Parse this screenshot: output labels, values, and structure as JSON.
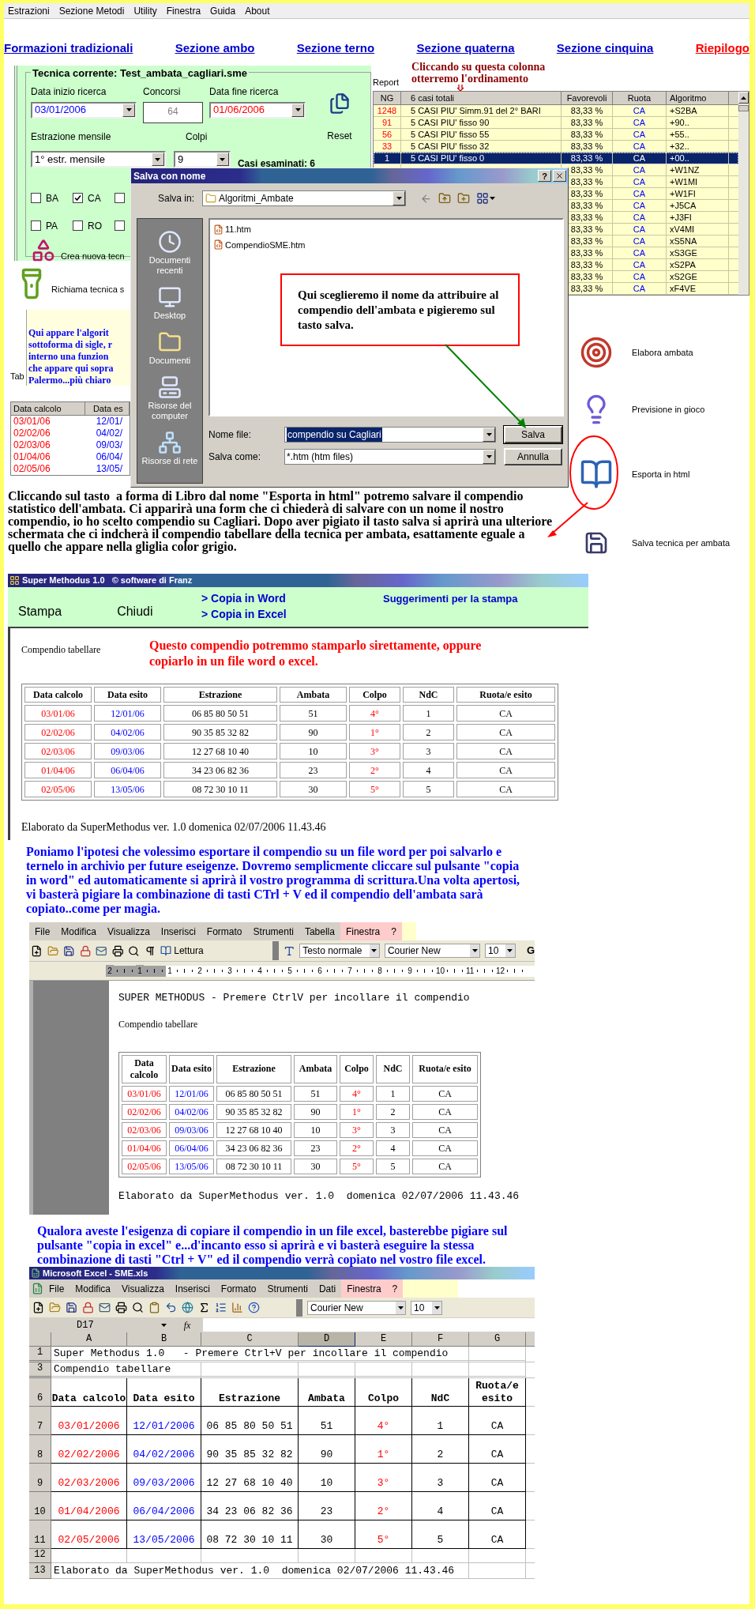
{
  "menu_bar": {
    "items": [
      "Estrazioni",
      "Sezione Metodi",
      "Utility",
      "Finestra",
      "Guida",
      "About"
    ]
  },
  "nav_links": [
    {
      "label": "Formazioni tradizionali",
      "kind": "section"
    },
    {
      "label": "Sezione ambo",
      "kind": "section"
    },
    {
      "label": "Sezione terno",
      "kind": "section"
    },
    {
      "label": "Sezione quaterna",
      "kind": "section"
    },
    {
      "label": "Sezione cinquina",
      "kind": "section"
    },
    {
      "label": "Riepilogo",
      "kind": "summary"
    }
  ],
  "technique_panel": {
    "title": "Tecnica corrente: Test_ambata_cagliari.sme",
    "start_label": "Data inizio ricerca",
    "start_value": "03/01/2006",
    "draws_label": "Concorsi",
    "draws_value": "64",
    "end_label": "Data fine ricerca",
    "end_value": "01/06/2006",
    "reset_label": "Reset",
    "monthly_label": "Estrazione mensile",
    "monthly_value": "1° estr. mensile",
    "shots_label": "Colpi",
    "shots_value": "9",
    "cases": "Casi esaminati: 6",
    "wheel_rows": [
      {
        "wheels": [
          {
            "label": "BA",
            "checked": false
          },
          {
            "label": "CA",
            "checked": true
          },
          {
            "checked": false
          }
        ]
      },
      {
        "wheels": [
          {
            "label": "PA",
            "checked": false
          },
          {
            "label": "RO",
            "checked": false
          },
          {
            "checked": false
          }
        ]
      }
    ],
    "create_label": "Crea nuova tecn"
  },
  "recall_label": "Richiama tecnica s",
  "algorithm_note": [
    "Qui appare l'algorit",
    "sottoforma di sigle, r",
    "interno una funzion",
    "che appare qui sopra",
    "Palermo...più chiaro"
  ],
  "tab_label": "Tab",
  "mini_table": {
    "columns": [
      {
        "label": "Data calcolo",
        "color": "#ff0000"
      },
      {
        "label": "Data es",
        "color": "#0000ff"
      }
    ],
    "rows": [
      [
        "03/01/06",
        "12/01/"
      ],
      [
        "02/02/06",
        "04/02/"
      ],
      [
        "02/03/06",
        "09/03/"
      ],
      [
        "01/04/06",
        "06/04/"
      ],
      [
        "02/05/06",
        "13/05/"
      ]
    ]
  },
  "sort_hint": "Cliccando su questa colonna otterremo l'ordinamento",
  "report_label": "Report",
  "report_table": {
    "columns": [
      {
        "label": "NG",
        "color": "#ff0000"
      },
      {
        "label": "6 casi totali"
      },
      {
        "label": "Favorevoli"
      },
      {
        "label": "Ruota",
        "color": "#0000ff"
      },
      {
        "label": "Algoritmo"
      }
    ],
    "rows": [
      {
        "cells": [
          "1248",
          "5 CASI PIU' Simm.91 del 2° BARI",
          "83,33 %",
          "CA",
          "+S2BA"
        ],
        "selected": false
      },
      {
        "cells": [
          "91",
          "5 CASI PIU' fisso 90",
          "83,33 %",
          "CA",
          "+90.."
        ],
        "selected": false
      },
      {
        "cells": [
          "56",
          "5 CASI PIU' fisso 55",
          "83,33 %",
          "CA",
          "+55.."
        ],
        "selected": false
      },
      {
        "cells": [
          "33",
          "5 CASI PIU' fisso 32",
          "83,33 %",
          "CA",
          "+32.."
        ],
        "selected": false
      },
      {
        "cells": [
          "1",
          "5 CASI PIU' fisso 0",
          "83,33 %",
          "CA",
          "+00.."
        ],
        "selected": true
      },
      {
        "cells": [
          null,
          null,
          "83,33 %",
          "CA",
          "+W1NZ"
        ],
        "selected": false
      },
      {
        "cells": [
          null,
          null,
          "83,33 %",
          "CA",
          "+W1MI"
        ],
        "selected": false
      },
      {
        "cells": [
          null,
          null,
          "83,33 %",
          "CA",
          "+W1FI"
        ],
        "selected": false
      },
      {
        "cells": [
          null,
          null,
          "83,33 %",
          "CA",
          "+J5CA"
        ],
        "selected": false
      },
      {
        "cells": [
          null,
          null,
          "83,33 %",
          "CA",
          "+J3FI"
        ],
        "selected": false
      },
      {
        "cells": [
          null,
          null,
          "83,33 %",
          "CA",
          "xV4MI"
        ],
        "selected": false
      },
      {
        "cells": [
          null,
          null,
          "83,33 %",
          "CA",
          "xS5NA"
        ],
        "selected": false
      },
      {
        "cells": [
          null,
          null,
          "83,33 %",
          "CA",
          "xS3GE"
        ],
        "selected": false
      },
      {
        "cells": [
          null,
          null,
          "83,33 %",
          "CA",
          "xS2PA"
        ],
        "selected": false
      },
      {
        "cells": [
          null,
          null,
          "83,33 %",
          "CA",
          "xS2GE"
        ],
        "selected": false
      },
      {
        "cells": [
          null,
          null,
          "83,33 %",
          "CA",
          "xF4VE"
        ],
        "selected": false
      }
    ]
  },
  "save_dialog": {
    "title": "Salva con nome",
    "help": "?",
    "save_in_label": "Salva in:",
    "folder": "Algoritmi_Ambate",
    "places": [
      {
        "label": "Documenti recenti",
        "kind": "recent"
      },
      {
        "label": "Desktop",
        "kind": "desktop"
      },
      {
        "label": "Documenti",
        "kind": "documents"
      },
      {
        "label": "Risorse del computer",
        "kind": "computer"
      },
      {
        "label": "Risorse di rete",
        "kind": "network"
      }
    ],
    "files": [
      "11.htm",
      "CompendioSME.htm"
    ],
    "filename_label": "Nome file:",
    "filename": "compendio su Cagliari",
    "type_label": "Salva come:",
    "type": "*.htm (htm files)",
    "save": "Salva",
    "cancel": "Annulla"
  },
  "callout": "Qui sceglieremo il nome da attribuire al compendio dell'ambata e pigieremo sul tasto salva.",
  "side_tools": [
    {
      "label": "Elabora ambata",
      "kind": "target",
      "circled": false
    },
    {
      "label": "Previsione in gioco",
      "kind": "bulb",
      "circled": false
    },
    {
      "label": "Esporta in html",
      "kind": "book",
      "circled": true
    },
    {
      "label": "Salva tecnica per ambata",
      "kind": "disk",
      "circled": false
    }
  ],
  "intro_paragraph": "Cliccando sul tasto  a forma di Libro dal nome \"Esporta in html\" potremo salvare il compendio statistico dell'ambata. Ci apparirà una form che ci chiederà di salvare con un nome il nostro compendio, io ho scelto compendio su Cagliari. Dopo aver pigiato il tasto salva si aprirà una ulteriore schermata che ci indcherà il compendio tabellare della tecnica per ambata, esattamente eguale a quello che appare nella gliglia color grigio.",
  "report_window": {
    "title": "Super Methodus 1.0   © software di Franz",
    "actions": [
      "Stampa",
      "Chiudi"
    ],
    "copy_links": [
      "> Copia in Word",
      "> Copia in Excel"
    ],
    "print_tips": "Suggerimenti per la stampa",
    "heading": "Compendio tabellare",
    "note": "Questo compendio potremmo stamparlo sirettamente, oppure copiarlo in un file word o excel.",
    "columns": [
      {
        "label": "Data calcolo",
        "color": "#ff0000"
      },
      {
        "label": "Data esito",
        "color": "#0000ff"
      },
      {
        "label": "Estrazione"
      },
      {
        "label": "Ambata"
      },
      {
        "label": "Colpo",
        "color": "#ff0000"
      },
      {
        "label": "NdC"
      },
      {
        "label": "Ruota/e esito"
      }
    ],
    "rows": [
      [
        "03/01/06",
        "12/01/06",
        "06 85 80 50 51",
        "51",
        "4°",
        "1",
        "CA"
      ],
      [
        "02/02/06",
        "04/02/06",
        "90 35 85 32 82",
        "90",
        "1°",
        "2",
        "CA"
      ],
      [
        "02/03/06",
        "09/03/06",
        "12 27 68 10 40",
        "10",
        "3°",
        "3",
        "CA"
      ],
      [
        "01/04/06",
        "06/04/06",
        "34 23 06 82 36",
        "23",
        "2°",
        "4",
        "CA"
      ],
      [
        "02/05/06",
        "13/05/06",
        "08 72 30 10 11",
        "30",
        "5°",
        "5",
        "CA"
      ]
    ],
    "footer": "Elaborato da SuperMethodus ver. 1.0  domenica 02/07/2006 11.43.46"
  },
  "word_paragraph": "Poniamo l'ipotesi che volessimo esportare il compendio su un file word per poi salvarlo e ternelo in archivio per future eseigenze. Dovremo semplicmente cliccare sul pulsante \"copia  in word\" ed automaticamente si aprirà il vostro programma di scrittura.Una volta apertosi, vi basterà pigiare la combinazione di tasti CTrl + V ed il compendio dell'ambata sarà copiato..come per magia.",
  "word_window": {
    "menu": [
      {
        "label": "File",
        "highlighted": false
      },
      {
        "label": "Modifica",
        "highlighted": false
      },
      {
        "label": "Visualizza",
        "highlighted": false
      },
      {
        "label": "Inserisci",
        "highlighted": false
      },
      {
        "label": "Formato",
        "highlighted": false
      },
      {
        "label": "Strumenti",
        "highlighted": false
      },
      {
        "label": "Tabella",
        "highlighted": false
      },
      {
        "label": "Finestra",
        "highlighted": true
      },
      {
        "label": "?",
        "highlighted": true
      }
    ],
    "reading": "Lettura",
    "style": "Testo normale",
    "font": "Courier New",
    "size": "10",
    "bold": "G",
    "ruler": [
      "2",
      "1",
      "1",
      "2",
      "3",
      "4",
      "5",
      "6",
      "7",
      "8",
      "9",
      "10",
      "11",
      "12"
    ],
    "title_line": "SUPER METHODUS - Premere CtrlV per incollare il compendio",
    "heading": "Compendio tabellare",
    "columns": [
      {
        "label": "Data calcolo",
        "color": "#ff0000"
      },
      {
        "label": "Data esito",
        "color": "#0000ff"
      },
      {
        "label": "Estrazione"
      },
      {
        "label": "Ambata"
      },
      {
        "label": "Colpo",
        "color": "#ff0000"
      },
      {
        "label": "NdC"
      },
      {
        "label": "Ruota/e esito"
      }
    ],
    "rows": [
      [
        "03/01/06",
        "12/01/06",
        "06 85 80 50 51",
        "51",
        "4°",
        "1",
        "CA"
      ],
      [
        "02/02/06",
        "04/02/06",
        "90 35 85 32 82",
        "90",
        "1°",
        "2",
        "CA"
      ],
      [
        "02/03/06",
        "09/03/06",
        "12 27 68 10 40",
        "10",
        "3°",
        "3",
        "CA"
      ],
      [
        "01/04/06",
        "06/04/06",
        "34 23 06 82 36",
        "23",
        "2°",
        "4",
        "CA"
      ],
      [
        "02/05/06",
        "13/05/06",
        "08 72 30 10 11",
        "30",
        "5°",
        "5",
        "CA"
      ]
    ],
    "footer": "Elaborato da SuperMethodus ver. 1.0  domenica 02/07/2006 11.43.46"
  },
  "excel_paragraph": "Qualora aveste l'esigenza di copiare il compendio in un file excel, basterebbe pigiare sul pulsante \"copia in excel\" e...d'incanto esso si aprirà e vi basterà eseguire la stessa combinazione di tasti \"Ctrl + V\" ed il compendio verrà copiato nel vostro file excel.",
  "excel_window": {
    "title": "Microsoft Excel - SME.xls",
    "menu": [
      {
        "label": "File",
        "highlighted": false
      },
      {
        "label": "Modifica",
        "highlighted": false
      },
      {
        "label": "Visualizza",
        "highlighted": false
      },
      {
        "label": "Inserisci",
        "highlighted": false
      },
      {
        "label": "Formato",
        "highlighted": false
      },
      {
        "label": "Strumenti",
        "highlighted": false
      },
      {
        "label": "Dati",
        "highlighted": false
      },
      {
        "label": "Finestra",
        "highlighted": true
      },
      {
        "label": "?",
        "highlighted": true
      }
    ],
    "font": "Courier New",
    "size": "10",
    "cell_ref": "D17",
    "function_label": "fx",
    "columns": [
      {
        "label": "A",
        "selected": false
      },
      {
        "label": "B",
        "selected": false
      },
      {
        "label": "C",
        "selected": false
      },
      {
        "label": "D",
        "selected": true
      },
      {
        "label": "E",
        "selected": false
      },
      {
        "label": "F",
        "selected": false
      },
      {
        "label": "G",
        "selected": false
      }
    ],
    "rows": [
      {
        "num": "1",
        "kind": "text",
        "text": "Super Methodus 1.0   - Premere Ctrl+V per incollare il compendio"
      },
      {
        "num": "3",
        "kind": "text",
        "text": "Compendio tabellare"
      },
      {
        "num": "6",
        "kind": "header",
        "cells": [
          {
            "label": "Data calcolo",
            "color": "#ff0000"
          },
          {
            "label": "Data esito",
            "color": "#0000ff"
          },
          {
            "label": "Estrazione"
          },
          {
            "label": "Ambata"
          },
          {
            "label": "Colpo",
            "color": "#ff0000"
          },
          {
            "label": "NdC"
          },
          {
            "label": "Ruota/e esito"
          }
        ]
      },
      {
        "num": "7",
        "kind": "data",
        "cells": [
          "03/01/2006",
          "12/01/2006",
          "06 85 80 50 51",
          "51",
          "4°",
          "1",
          "CA"
        ]
      },
      {
        "num": "8",
        "kind": "data",
        "cells": [
          "02/02/2006",
          "04/02/2006",
          "90 35 85 32 82",
          "90",
          "1°",
          "2",
          "CA"
        ]
      },
      {
        "num": "9",
        "kind": "data",
        "cells": [
          "02/03/2006",
          "09/03/2006",
          "12 27 68 10 40",
          "10",
          "3°",
          "3",
          "CA"
        ]
      },
      {
        "num": "10",
        "kind": "data",
        "cells": [
          "01/04/2006",
          "06/04/2006",
          "34 23 06 82 36",
          "23",
          "2°",
          "4",
          "CA"
        ]
      },
      {
        "num": "11",
        "kind": "data",
        "cells": [
          "02/05/2006",
          "13/05/2006",
          "08 72 30 10 11",
          "30",
          "5°",
          "5",
          "CA"
        ]
      },
      {
        "num": "12",
        "kind": "blank"
      },
      {
        "num": "13",
        "kind": "text",
        "text": "Elaborato da SuperMethodus ver. 1.0  domenica 02/07/2006 11.43.46"
      }
    ]
  }
}
